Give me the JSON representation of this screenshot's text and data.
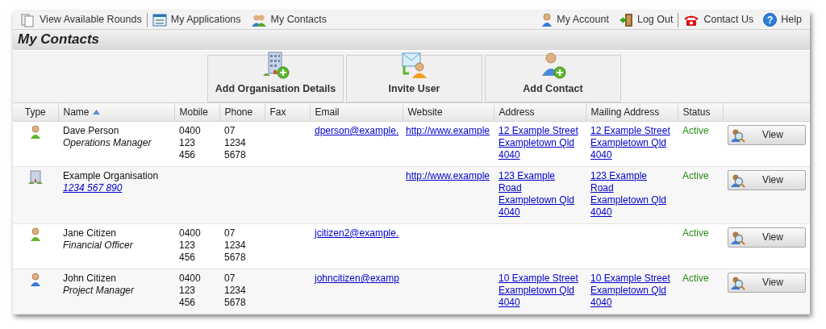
{
  "nav_left": [
    [
      {
        "label": "View Available Rounds"
      }
    ],
    [
      {
        "label": "My Applications"
      },
      {
        "label": "My Contacts"
      }
    ]
  ],
  "nav_right": [
    [
      {
        "label": "My Account"
      },
      {
        "label": "Log Out"
      }
    ],
    [
      {
        "label": "Contact Us"
      },
      {
        "label": "Help",
        "icon_text": "?"
      }
    ]
  ],
  "page_title": "My Contacts",
  "toolbar": [
    {
      "label": "Add Organisation Details"
    },
    {
      "label": "Invite User"
    },
    {
      "label": "Add Contact"
    }
  ],
  "table": {
    "columns": [
      {
        "label": "Type",
        "sorted": false
      },
      {
        "label": "Name",
        "sorted": true
      },
      {
        "label": "Mobile",
        "sorted": false
      },
      {
        "label": "Phone",
        "sorted": false
      },
      {
        "label": "Fax",
        "sorted": false
      },
      {
        "label": "Email",
        "sorted": false
      },
      {
        "label": "Website",
        "sorted": false
      },
      {
        "label": "Address",
        "sorted": false
      },
      {
        "label": "Mailing Address",
        "sorted": false
      },
      {
        "label": "Status",
        "sorted": false
      }
    ],
    "rows": [
      {
        "kind": "contact",
        "name": "Dave Person",
        "subtitle": {
          "text": "Operations Manager",
          "kind": "role"
        },
        "mobile": [
          "0400",
          "123",
          "456"
        ],
        "phone": [
          "07",
          "1234",
          "5678"
        ],
        "email": "dperson@example.",
        "website": "http://www.example",
        "address": [
          "12 Example Street",
          "Exampletown Qld",
          "4040"
        ],
        "mailing_address": [
          "12 Example Street",
          "Exampletown Qld",
          "4040"
        ],
        "status": "Active",
        "button": "View"
      },
      {
        "kind": "organisation",
        "name": "Example Organisation",
        "subtitle": {
          "text": "1234 567 890",
          "kind": "number"
        },
        "mobile": [],
        "phone": [],
        "email": "",
        "website": "http://www.example",
        "address": [
          "123 Example",
          "Road",
          "Exampletown Qld",
          "4040"
        ],
        "mailing_address": [
          "123 Example",
          "Road",
          "Exampletown Qld",
          "4040"
        ],
        "status": "Active",
        "button": "View"
      },
      {
        "kind": "contact",
        "name": "Jane Citizen",
        "subtitle": {
          "text": "Financial Officer",
          "kind": "role"
        },
        "mobile": [
          "0400",
          "123",
          "456"
        ],
        "phone": [
          "07",
          "1234",
          "5678"
        ],
        "email": "jcitizen2@example.",
        "website": "",
        "address": [],
        "mailing_address": [],
        "status": "Active",
        "button": "View"
      },
      {
        "kind": "user",
        "name": "John Citizen",
        "subtitle": {
          "text": "Project Manager",
          "kind": "role"
        },
        "mobile": [
          "0400",
          "123",
          "456"
        ],
        "phone": [
          "07",
          "1234",
          "5678"
        ],
        "email": "johncitizen@examp",
        "website": "",
        "address": [
          "10 Example Street",
          "Exampletown Qld",
          "4040"
        ],
        "mailing_address": [
          "10 Example Street",
          "Exampletown Qld",
          "4040"
        ],
        "status": "Active",
        "button": "View"
      }
    ]
  }
}
